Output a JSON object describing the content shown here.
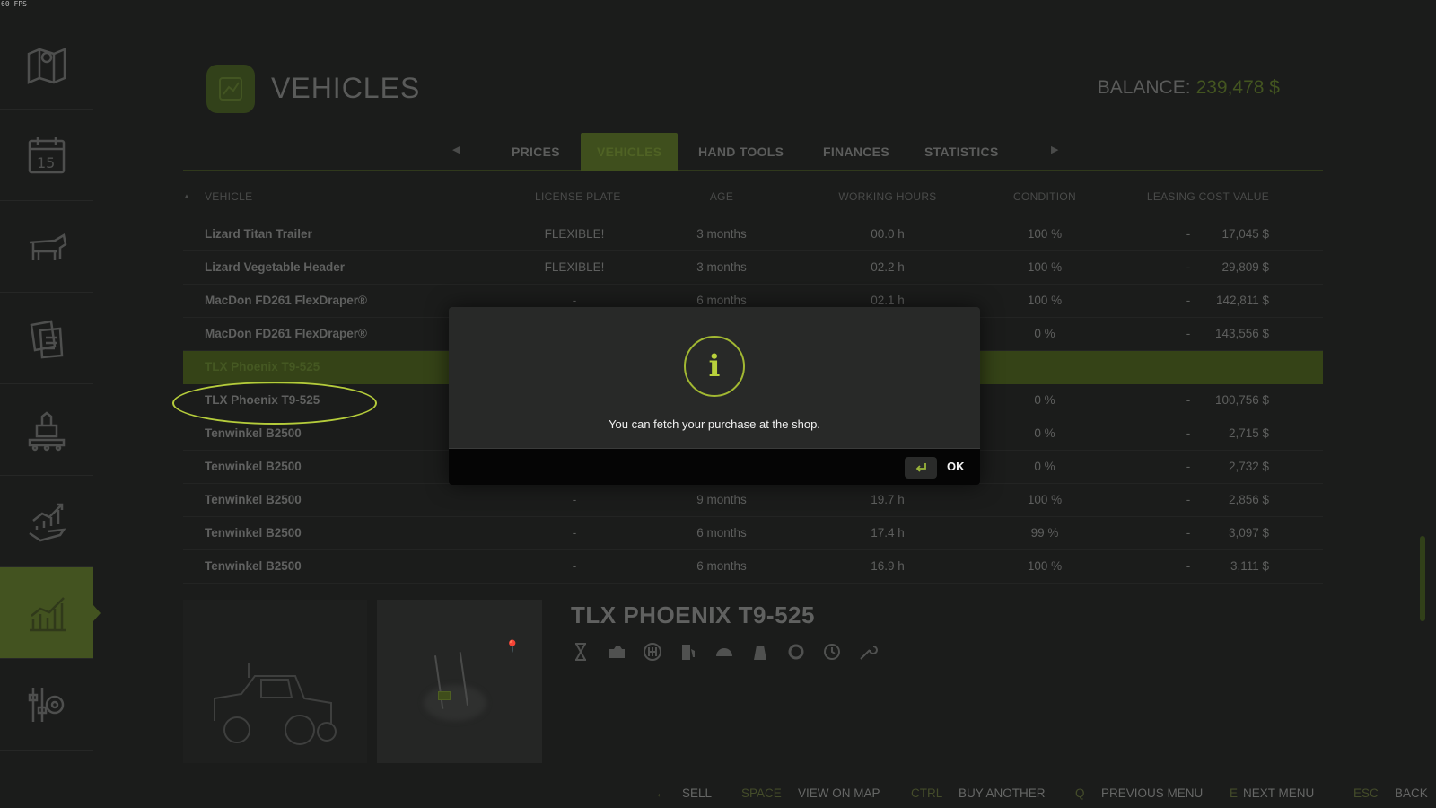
{
  "fps": "60 FPS",
  "header": {
    "title": "VEHICLES",
    "balance_label": "BALANCE:",
    "balance_value": "239,478 $"
  },
  "tabs": [
    "PRICES",
    "VEHICLES",
    "HAND TOOLS",
    "FINANCES",
    "STATISTICS"
  ],
  "active_tab": "VEHICLES",
  "table": {
    "columns": [
      "VEHICLE",
      "LICENSE PLATE",
      "AGE",
      "WORKING HOURS",
      "CONDITION",
      "LEASING COST",
      "VALUE"
    ],
    "rows": [
      {
        "vehicle": "Lizard Titan Trailer",
        "plate": "FLEXIBLE!",
        "age": "3 months",
        "hours": "00.0 h",
        "condition": "100 %",
        "lease": "-",
        "value": "17,045 $"
      },
      {
        "vehicle": "Lizard Vegetable Header",
        "plate": "FLEXIBLE!",
        "age": "3 months",
        "hours": "02.2 h",
        "condition": "100 %",
        "lease": "-",
        "value": "29,809 $"
      },
      {
        "vehicle": "MacDon FD261 FlexDraper®",
        "plate": "-",
        "age": "6 months",
        "hours": "02.1 h",
        "condition": "100 %",
        "lease": "-",
        "value": "142,811 $"
      },
      {
        "vehicle": "MacDon FD261 FlexDraper®",
        "plate": "",
        "age": "",
        "hours": "",
        "condition": "0 %",
        "lease": "-",
        "value": "143,556 $"
      },
      {
        "vehicle": "TLX Phoenix T9-525",
        "plate": "",
        "age": "",
        "hours": "",
        "condition": "",
        "lease": "",
        "value": "",
        "selected": true
      },
      {
        "vehicle": "TLX Phoenix T9-525",
        "plate": "",
        "age": "",
        "hours": "",
        "condition": "0 %",
        "lease": "-",
        "value": "100,756 $"
      },
      {
        "vehicle": "Tenwinkel B2500",
        "plate": "",
        "age": "",
        "hours": "",
        "condition": "0 %",
        "lease": "-",
        "value": "2,715 $"
      },
      {
        "vehicle": "Tenwinkel B2500",
        "plate": "",
        "age": "",
        "hours": "",
        "condition": "0 %",
        "lease": "-",
        "value": "2,732 $"
      },
      {
        "vehicle": "Tenwinkel B2500",
        "plate": "-",
        "age": "9 months",
        "hours": "19.7 h",
        "condition": "100 %",
        "lease": "-",
        "value": "2,856 $"
      },
      {
        "vehicle": "Tenwinkel B2500",
        "plate": "-",
        "age": "6 months",
        "hours": "17.4 h",
        "condition": "99 %",
        "lease": "-",
        "value": "3,097 $"
      },
      {
        "vehicle": "Tenwinkel B2500",
        "plate": "-",
        "age": "6 months",
        "hours": "16.9 h",
        "condition": "100 %",
        "lease": "-",
        "value": "3,111 $"
      }
    ]
  },
  "details": {
    "title": "TLX PHOENIX T9-525"
  },
  "footer": [
    {
      "key": "←",
      "label": "SELL"
    },
    {
      "key": "SPACE",
      "label": "VIEW ON MAP"
    },
    {
      "key": "CTRL",
      "label": "BUY ANOTHER"
    },
    {
      "key": "Q",
      "label": "PREVIOUS MENU"
    },
    {
      "key": "E",
      "label": "NEXT MENU"
    },
    {
      "key": "ESC",
      "label": "BACK"
    }
  ],
  "dialog": {
    "message": "You can fetch your purchase at the shop.",
    "ok_label": "OK"
  },
  "colors": {
    "accent": "#b5cc3b",
    "dim_green": "#435320",
    "background": "#1b1c1b"
  }
}
